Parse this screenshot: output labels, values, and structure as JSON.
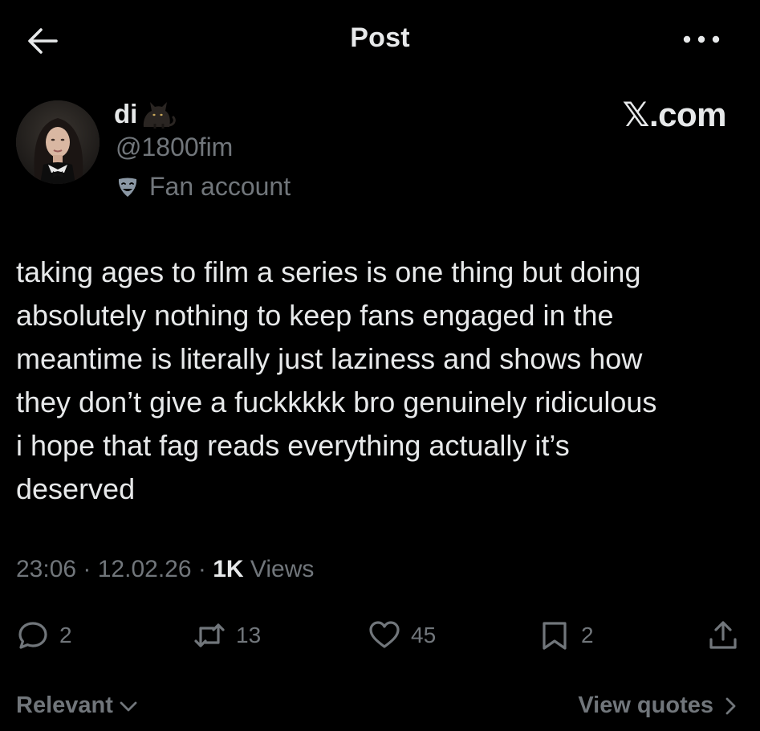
{
  "header": {
    "title": "Post",
    "back_icon": "arrow-left-icon",
    "more_icon": "more-horizontal-icon"
  },
  "author": {
    "display_name": "di",
    "name_emoji": "cat-emoji",
    "handle": "@1800fim",
    "label_icon": "theater-masks-icon",
    "label": "Fan account"
  },
  "watermark": "𝕏.com",
  "post": {
    "text": "taking ages to film a series is one thing but doing\nabsolutely nothing to keep fans engaged in the\nmeantime is literally just laziness and shows how\nthey don’t give a fuckkkkk bro genuinely ridiculous\ni hope that fag reads everything actually it’s\ndeserved"
  },
  "meta": {
    "time": "23:06",
    "sep1": " · ",
    "date": "12.02.26",
    "sep2": " · ",
    "views_count": "1K",
    "views_label": " Views"
  },
  "actions": {
    "reply": {
      "icon": "reply-icon",
      "count": "2"
    },
    "repost": {
      "icon": "repost-icon",
      "count": "13"
    },
    "like": {
      "icon": "heart-icon",
      "count": "45"
    },
    "bookmark": {
      "icon": "bookmark-icon",
      "count": "2"
    },
    "share": {
      "icon": "share-icon"
    }
  },
  "footer": {
    "sort_label": "Relevant",
    "quotes_label": "View quotes"
  },
  "colors": {
    "background": "#000000",
    "primary_text": "#e7e9ea",
    "secondary_text": "#71767b"
  }
}
